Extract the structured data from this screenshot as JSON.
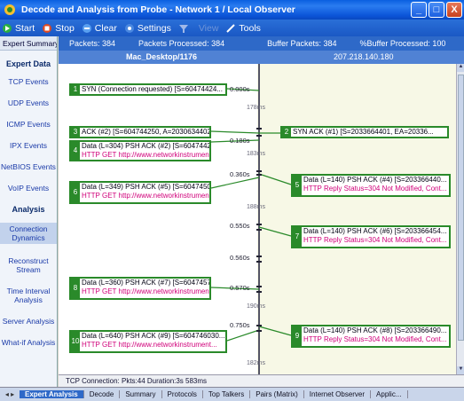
{
  "window": {
    "title": "Decode and Analysis from Probe - Network 1 / Local Observer",
    "buttons": [
      "_",
      "□",
      "X"
    ]
  },
  "toolbar": [
    {
      "label": "Start",
      "icon": "start-icon",
      "disabled": false
    },
    {
      "label": "Stop",
      "icon": "stop-icon",
      "disabled": false
    },
    {
      "label": "Clear",
      "icon": "clear-icon",
      "disabled": false
    },
    {
      "label": "Settings",
      "icon": "settings-icon",
      "disabled": false
    },
    {
      "label": "",
      "icon": "filter-icon",
      "disabled": true
    },
    {
      "label": "View",
      "icon": "",
      "disabled": true
    },
    {
      "label": "Tools",
      "icon": "tools-icon",
      "disabled": false
    }
  ],
  "sidebar": {
    "header": "Expert Summary",
    "sections": [
      {
        "title": "Expert Data",
        "items": [
          "TCP Events",
          "UDP Events",
          "ICMP Events",
          "IPX Events",
          "NetBIOS Events",
          "VoIP Events"
        ]
      },
      {
        "title": "Analysis",
        "items": [
          "Connection Dynamics",
          "Reconstruct Stream",
          "Time Interval Analysis",
          "Server Analysis",
          "What-if Analysis"
        ]
      }
    ],
    "active_item": "Connection Dynamics"
  },
  "stats": {
    "packets": "Packets: 384",
    "processed": "Packets Processed: 384",
    "buffer": "Buffer Packets: 384",
    "buffer_processed": "%Buffer Processed: 100"
  },
  "hosts": {
    "left": "Mac_Desktop/1176",
    "right": "207.218.140.180"
  },
  "packets": [
    {
      "n": "1",
      "text": "SYN (Connection requested) [S=60474424...",
      "http": ""
    },
    {
      "n": "3",
      "text": "ACK (#2) [S=604744250, A=2030634402...",
      "http": ""
    },
    {
      "n": "4",
      "text": "Data (L=304) PSH ACK (#2) [S=60474425...",
      "http": "HTTP GET http://www.networkinstruments..."
    },
    {
      "n": "2",
      "text": "SYN ACK (#1) [S=2033664401, EA=20336...",
      "http": ""
    },
    {
      "n": "5",
      "text": "Data (L=140) PSH ACK (#4) [S=203366440...",
      "http": "HTTP Reply Status=304 Not Modified, Cont..."
    },
    {
      "n": "6",
      "text": "Data (L=349) PSH ACK (#5) [S=604745054...",
      "http": "HTTP GET http://www.networkinstruments..."
    },
    {
      "n": "7",
      "text": "Data (L=140) PSH ACK (#6) [S=203366454...",
      "http": "HTTP Reply Status=304 Not Modified, Cont..."
    },
    {
      "n": "8",
      "text": "Data (L=360) PSH ACK (#7) [S=604745703...",
      "http": "HTTP GET http://www.networkinstruments..."
    },
    {
      "n": "9",
      "text": "Data (L=140) PSH ACK (#8) [S=203366490...",
      "http": "HTTP Reply Status=304 Not Modified, Cont..."
    },
    {
      "n": "10",
      "text": "Data (L=640) PSH ACK (#9) [S=604746030...",
      "http": "HTTP GET http://www.networkinstrument..."
    }
  ],
  "timestamps": [
    "0.000s",
    "178ms",
    "0.180s",
    "183ms",
    "0.360s",
    "188ms",
    "0.550s",
    "0.560s",
    "0.570s",
    "190ms",
    "0.750s",
    "182ms"
  ],
  "status": "TCP Connection: Pkts:44 Duration:3s 583ms",
  "tabs": [
    "Expert Analysis",
    "Decode",
    "Summary",
    "Protocols",
    "Top Talkers",
    "Pairs (Matrix)",
    "Internet Observer",
    "Applic..."
  ],
  "active_tab": "Expert Analysis",
  "colors": {
    "title": "#0a5fe0",
    "header": "#2e69c8",
    "packet_border": "#2a8a2a",
    "http_text": "#d0007a"
  }
}
